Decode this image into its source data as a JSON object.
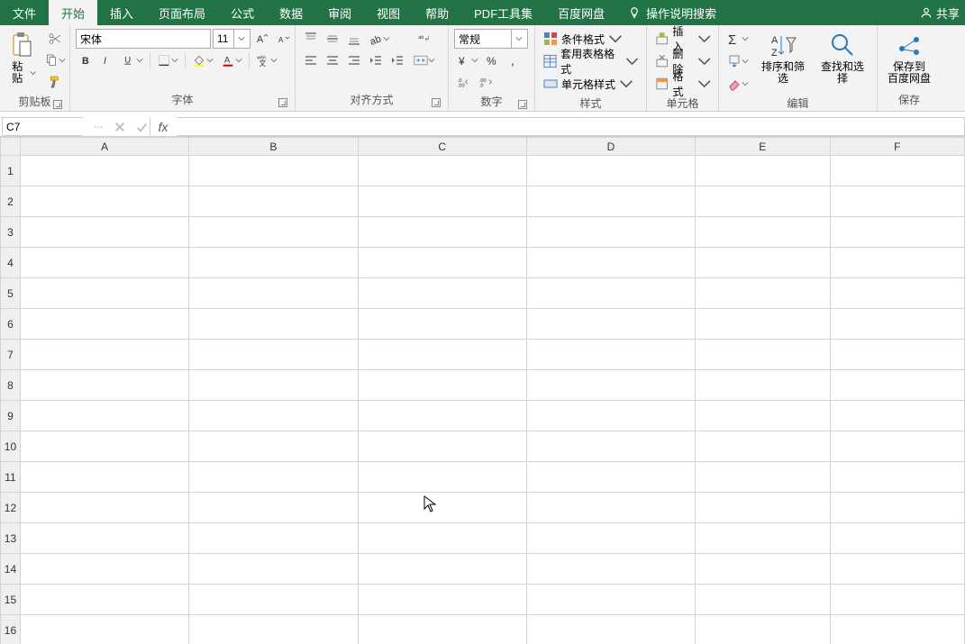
{
  "tabs": {
    "items": [
      "文件",
      "开始",
      "插入",
      "页面布局",
      "公式",
      "数据",
      "审阅",
      "视图",
      "帮助",
      "PDF工具集",
      "百度网盘"
    ],
    "active_index": 1,
    "tell_me": "操作说明搜索",
    "share": "共享"
  },
  "ribbon": {
    "clipboard": {
      "paste": "粘贴",
      "label": "剪贴板"
    },
    "font": {
      "name": "宋体",
      "size": "11",
      "pinyin": "wén",
      "label": "字体"
    },
    "alignment": {
      "wrap": "ab",
      "label": "对齐方式"
    },
    "number": {
      "format": "常规",
      "label": "数字"
    },
    "styles": {
      "cond": "条件格式",
      "table": "套用表格格式",
      "cell": "单元格样式",
      "label": "样式"
    },
    "cells": {
      "insert": "插入",
      "delete": "删除",
      "format": "格式",
      "label": "单元格"
    },
    "editing": {
      "sort": "排序和筛选",
      "find": "查找和选择",
      "label": "编辑"
    },
    "save": {
      "main": "保存到\n百度网盘",
      "label": "保存"
    }
  },
  "formula_bar": {
    "cell_ref": "C7",
    "formula": ""
  },
  "grid": {
    "columns": [
      "A",
      "B",
      "C",
      "D",
      "E",
      "F"
    ],
    "rows": [
      "1",
      "2",
      "3",
      "4",
      "5",
      "6",
      "7",
      "8",
      "9",
      "10",
      "11",
      "12",
      "13",
      "14",
      "15",
      "16"
    ]
  }
}
